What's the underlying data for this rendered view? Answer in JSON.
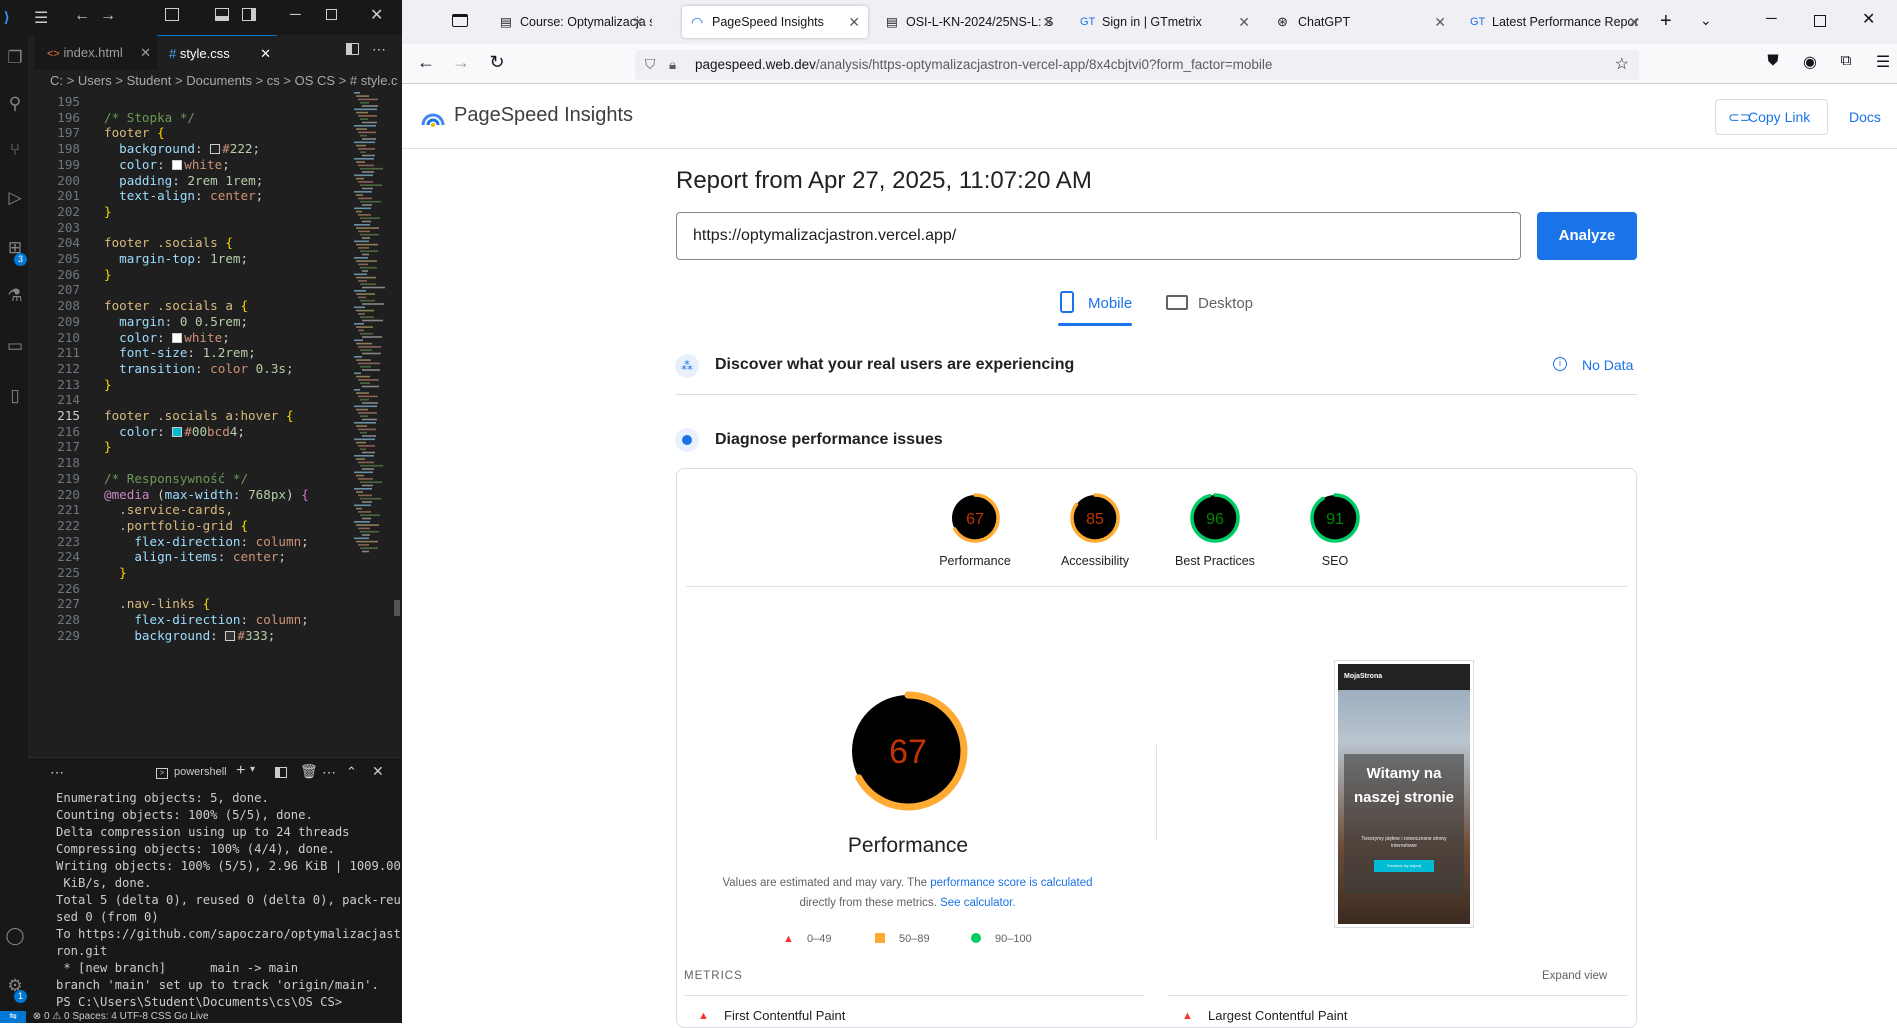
{
  "vscode": {
    "tabs": [
      {
        "label": "index.html"
      },
      {
        "label": "style.css"
      }
    ],
    "breadcrumb": "C: > Users > Student > Documents > cs > OS CS > # style.c",
    "code_lines": [
      {
        "n": "195",
        "t": ""
      },
      {
        "n": "196",
        "t": "  /* Stopka */"
      },
      {
        "n": "197",
        "t": "  footer {"
      },
      {
        "n": "198",
        "t": "    background: #222;"
      },
      {
        "n": "199",
        "t": "    color: white;"
      },
      {
        "n": "200",
        "t": "    padding: 2rem 1rem;"
      },
      {
        "n": "201",
        "t": "    text-align: center;"
      },
      {
        "n": "202",
        "t": "  }"
      },
      {
        "n": "203",
        "t": ""
      },
      {
        "n": "204",
        "t": "  footer .socials {"
      },
      {
        "n": "205",
        "t": "    margin-top: 1rem;"
      },
      {
        "n": "206",
        "t": "  }"
      },
      {
        "n": "207",
        "t": ""
      },
      {
        "n": "208",
        "t": "  footer .socials a {"
      },
      {
        "n": "209",
        "t": "    margin: 0 0.5rem;"
      },
      {
        "n": "210",
        "t": "    color: white;"
      },
      {
        "n": "211",
        "t": "    font-size: 1.2rem;"
      },
      {
        "n": "212",
        "t": "    transition: color 0.3s;"
      },
      {
        "n": "213",
        "t": "  }"
      },
      {
        "n": "214",
        "t": ""
      },
      {
        "n": "215",
        "t": "  footer .socials a:hover {"
      },
      {
        "n": "216",
        "t": "    color: #00bcd4;"
      },
      {
        "n": "217",
        "t": "  }"
      },
      {
        "n": "218",
        "t": ""
      },
      {
        "n": "219",
        "t": "  /* Responsywność */"
      },
      {
        "n": "220",
        "t": "  @media (max-width: 768px) {"
      },
      {
        "n": "221",
        "t": "    .service-cards,"
      },
      {
        "n": "222",
        "t": "    .portfolio-grid {"
      },
      {
        "n": "223",
        "t": "      flex-direction: column;"
      },
      {
        "n": "224",
        "t": "      align-items: center;"
      },
      {
        "n": "225",
        "t": "    }"
      },
      {
        "n": "226",
        "t": ""
      },
      {
        "n": "227",
        "t": "    .nav-links {"
      },
      {
        "n": "228",
        "t": "      flex-direction: column;"
      },
      {
        "n": "229",
        "t": "      background: #333;"
      }
    ],
    "terminal": {
      "name": "powershell",
      "lines": [
        "Enumerating objects: 5, done.",
        "Counting objects: 100% (5/5), done.",
        "Delta compression using up to 24 threads",
        "Compressing objects: 100% (4/4), done.",
        "Writing objects: 100% (5/5), 2.96 KiB | 1009.00",
        " KiB/s, done.",
        "Total 5 (delta 0), reused 0 (delta 0), pack-reu",
        "sed 0 (from 0)",
        "To https://github.com/sapoczaro/optymalizacjast",
        "ron.git",
        " * [new branch]      main -> main",
        "branch 'main' set up to track 'origin/main'.",
        "PS C:\\Users\\Student\\Documents\\cs\\OS CS> "
      ]
    },
    "status": "⊗ 0 ⚠ 0    Spaces: 4   UTF-8   CSS   Go Live",
    "badge": "3",
    "badge2": "1"
  },
  "browser": {
    "tabs": [
      {
        "label": "Course: Optymalizacja str"
      },
      {
        "label": "PageSpeed Insights"
      },
      {
        "label": "OSI-L-KN-2024/25NS-L: S"
      },
      {
        "label": "Sign in | GTmetrix"
      },
      {
        "label": "ChatGPT"
      },
      {
        "label": "Latest Performance Repor"
      }
    ],
    "url_host": "pagespeed.web.dev",
    "url_path": "/analysis/https-optymalizacjastron-vercel-app/8x4cbjtvi0?form_factor=mobile"
  },
  "psi": {
    "brand": "PageSpeed Insights",
    "copy_link": "Copy Link",
    "docs": "Docs",
    "report_title": "Report from Apr 27, 2025, 11:07:20 AM",
    "url_value": "https://optymalizacjastron.vercel.app/",
    "analyze": "Analyze",
    "form_tabs": [
      {
        "label": "Mobile"
      },
      {
        "label": "Desktop"
      }
    ],
    "discover": "Discover what your real users are experiencing",
    "no_data": "No Data",
    "diagnose": "Diagnose performance issues",
    "categories": [
      {
        "label": "Performance",
        "score": 67,
        "color": "#fa3"
      },
      {
        "label": "Accessibility",
        "score": 85,
        "color": "#fa3"
      },
      {
        "label": "Best Practices",
        "score": 96,
        "color": "#0c6"
      },
      {
        "label": "SEO",
        "score": 91,
        "color": "#0c6"
      }
    ],
    "big_score": 67,
    "big_label": "Performance",
    "note_a": "Values are estimated and may vary. The ",
    "note_link1": "performance score is calculated",
    "note_b": "directly from these metrics. ",
    "note_link2": "See calculator.",
    "legend": [
      {
        "label": "0–49",
        "color": "#f33"
      },
      {
        "label": "50–89",
        "color": "#fa3"
      },
      {
        "label": "90–100",
        "color": "#0c6"
      }
    ],
    "metrics_label": "METRICS",
    "expand": "Expand view",
    "metric1": "First Contentful Paint",
    "metric2": "Largest Contentful Paint",
    "thumb": {
      "brand": "MojaStrona",
      "heading": "Witamy na naszej stronie",
      "sub": "Tworzymy piękne i nowoczesne strony internetowe",
      "cta": "Dowiedz się więcej"
    }
  }
}
